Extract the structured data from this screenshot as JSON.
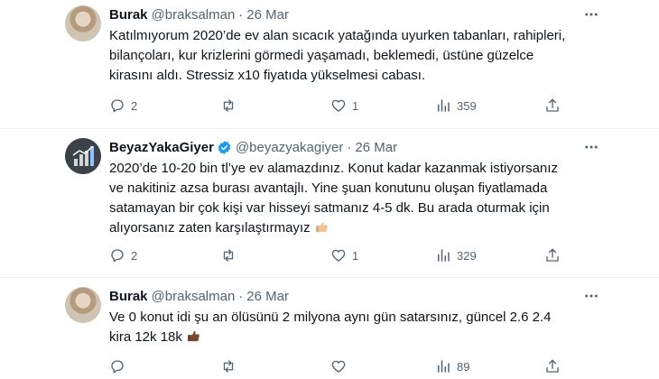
{
  "tweets": [
    {
      "name": "Burak",
      "handle": "@braksalman",
      "separator": "·",
      "date": "26 Mar",
      "verified": false,
      "avatar_icon": "user-photo",
      "text": "Katılmıyorum 2020’de ev alan sıcacık yatağında uyurken tabanları, rahipleri, bilançoları, kur krizlerini görmedi yaşamadı, beklemedi, üstüne güzelce kirasını aldı. Stressiz x10 fiyatıda yükselmesi cabası.",
      "replies": "2",
      "retweets": "",
      "likes": "1",
      "views": "359"
    },
    {
      "name": "BeyazYakaGiyer",
      "handle": "@beyazyakagiyer",
      "separator": "·",
      "date": "26 Mar",
      "verified": true,
      "avatar_icon": "chart-logo",
      "text": "2020’de 10-20 bin tl’ye ev alamazdınız. Konut kadar kazanmak istiyorsanız ve nakitiniz azsa burası avantajlı. Yine şuan konutunu oluşan fiyatlamada satamayan bir çok kişi var hisseyi satmanız 4-5 dk. Bu arada oturmak için alıyorsanız zaten karşılaştırmayız",
      "emoji": "thumbs-up-light",
      "replies": "2",
      "retweets": "",
      "likes": "1",
      "views": "329"
    },
    {
      "name": "Burak",
      "handle": "@braksalman",
      "separator": "·",
      "date": "26 Mar",
      "verified": false,
      "avatar_icon": "user-photo",
      "text": "Ve 0 konut idi şu an ölüsünü 2 milyona aynı gün satarsınız, güncel 2.6 2.4 kira 12k 18k",
      "emoji": "thumbs-up-dark",
      "replies": "",
      "retweets": "",
      "likes": "",
      "views": "89"
    }
  ],
  "colors": {
    "text": "#0f1419",
    "muted": "#536471",
    "verified": "#1d9bf0",
    "divider": "#eff3f4"
  }
}
